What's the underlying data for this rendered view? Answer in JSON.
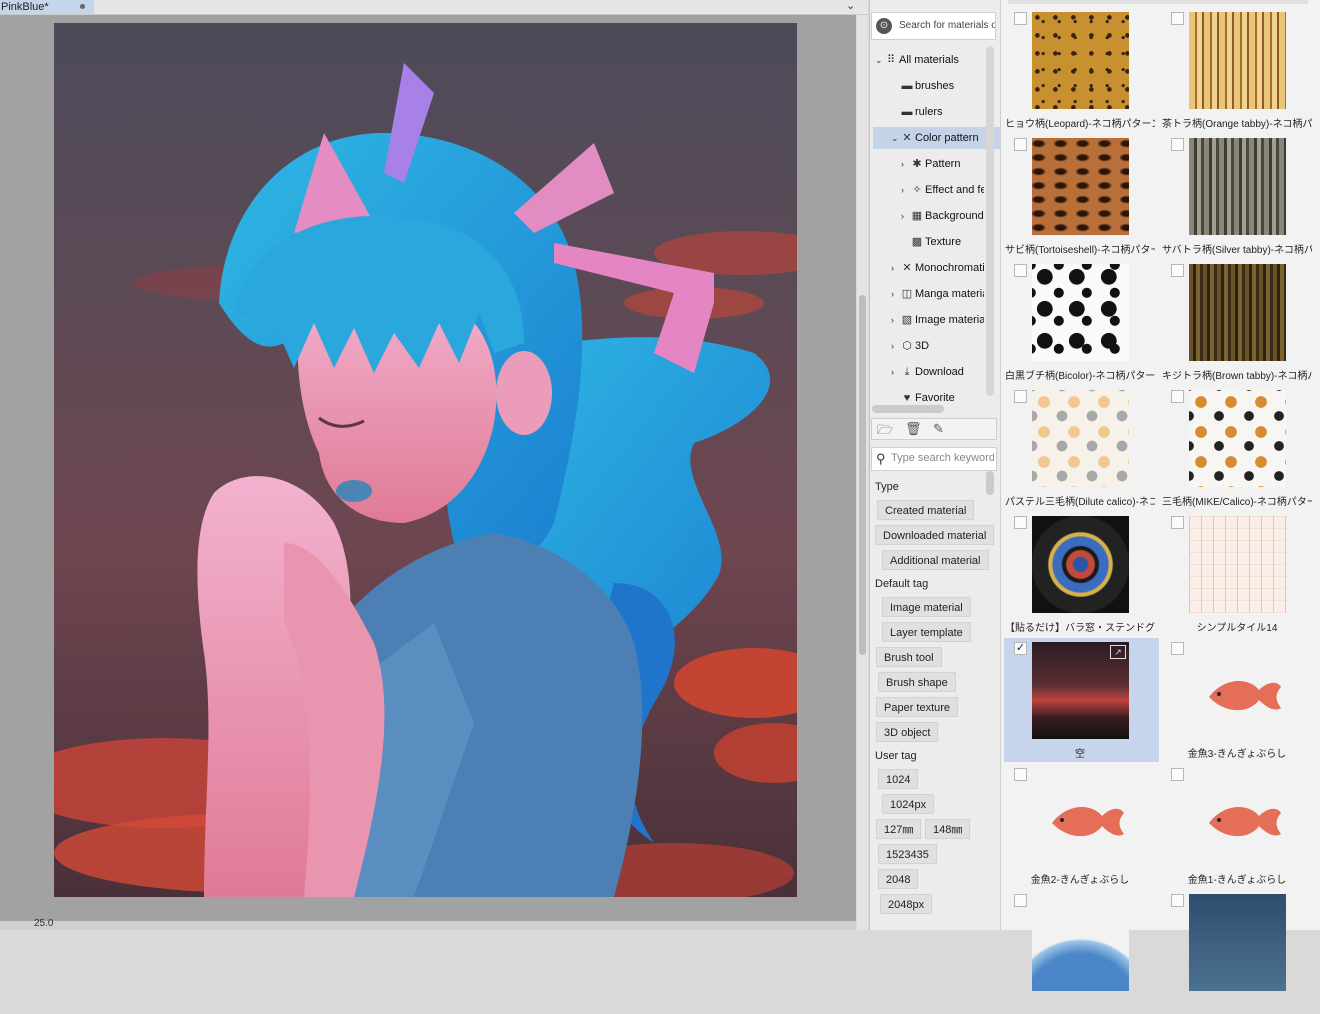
{
  "document": {
    "tab_title": "PinkBlue*",
    "zoom": "25.0"
  },
  "asset_search": {
    "label": "Search for materials on ASSETS",
    "logo_icon": "assets-logo-icon"
  },
  "tree": {
    "items": [
      {
        "label": "All materials",
        "icon": "grid-dots-icon",
        "depth": 0,
        "expanded": true
      },
      {
        "label": "brushes",
        "icon": "folder-icon",
        "depth": 1
      },
      {
        "label": "rulers",
        "icon": "folder-icon",
        "depth": 1
      },
      {
        "label": "Color pattern",
        "icon": "crossed-brushes-icon",
        "depth": 1,
        "expanded": true,
        "selected": true
      },
      {
        "label": "Pattern",
        "icon": "pattern-icon",
        "depth": 2
      },
      {
        "label": "Effect and feature",
        "icon": "sparkle-icon",
        "depth": 2
      },
      {
        "label": "Background",
        "icon": "background-icon",
        "depth": 2
      },
      {
        "label": "Texture",
        "icon": "texture-icon",
        "depth": 2
      },
      {
        "label": "Monochromatic pattern",
        "icon": "crossed-brushes-icon",
        "depth": 1
      },
      {
        "label": "Manga material",
        "icon": "manga-icon",
        "depth": 1
      },
      {
        "label": "Image material",
        "icon": "image-icon",
        "depth": 1
      },
      {
        "label": "3D",
        "icon": "cube-icon",
        "depth": 1
      },
      {
        "label": "Download",
        "icon": "download-icon",
        "depth": 1
      },
      {
        "label": "Favorite",
        "icon": "heart-icon",
        "depth": 1
      }
    ],
    "toolbar": [
      "new-folder-icon",
      "delete-icon",
      "edit-icon"
    ]
  },
  "keyword_search": {
    "placeholder": "Type search keyword"
  },
  "filters": {
    "type_label": "Type",
    "type_tags": [
      "Created material",
      "Downloaded material",
      "Additional material"
    ],
    "default_tag_label": "Default tag",
    "default_tags": [
      "Image material",
      "Layer template",
      "Brush tool",
      "Brush shape",
      "Paper texture",
      "3D object"
    ],
    "user_tag_label": "User tag",
    "user_tags": [
      "1024",
      "1024px",
      "127㎜",
      "148㎜",
      "1523435",
      "2048",
      "2048px"
    ]
  },
  "materials": [
    {
      "caption": "ヒョウ柄(Leopard)-ネコ柄パターンセット",
      "checked": false,
      "selected": false
    },
    {
      "caption": "茶トラ柄(Orange tabby)-ネコ柄パターンセット",
      "checked": false,
      "selected": false
    },
    {
      "caption": "サビ柄(Tortoiseshell)-ネコ柄パターンセット",
      "checked": false,
      "selected": false
    },
    {
      "caption": "サバトラ柄(Silver tabby)-ネコ柄パターンセット",
      "checked": false,
      "selected": false
    },
    {
      "caption": "白黒ブチ柄(Bicolor)-ネコ柄パターンセット",
      "checked": false,
      "selected": false
    },
    {
      "caption": "キジトラ柄(Brown tabby)-ネコ柄パターンセット",
      "checked": false,
      "selected": false
    },
    {
      "caption": "パステル三毛柄(Dilute calico)-ネコ柄パターンセット",
      "checked": false,
      "selected": false
    },
    {
      "caption": "三毛柄(MIKE/Calico)-ネコ柄パターンセット",
      "checked": false,
      "selected": false
    },
    {
      "caption": "【貼るだけ】バラ窓・ステンドグラス素材_カラー",
      "checked": false,
      "selected": false
    },
    {
      "caption": "シンプルタイル14",
      "checked": false,
      "selected": false
    },
    {
      "caption": "空",
      "checked": true,
      "selected": true
    },
    {
      "caption": "金魚3-きんぎょぶらし",
      "checked": false,
      "selected": false
    },
    {
      "caption": "金魚2-きんぎょぶらし",
      "checked": false,
      "selected": false
    },
    {
      "caption": "金魚1-きんぎょぶらし",
      "checked": false,
      "selected": false
    },
    {
      "caption": "",
      "checked": false,
      "selected": false
    },
    {
      "caption": "",
      "checked": false,
      "selected": false
    }
  ],
  "colors": {
    "selection": "#c4d3e8",
    "canvas_bg": "#a2a2a2",
    "hair": "#1fa9d8",
    "skin": "#f0a0c0",
    "ribbon": "#e47fc0"
  }
}
